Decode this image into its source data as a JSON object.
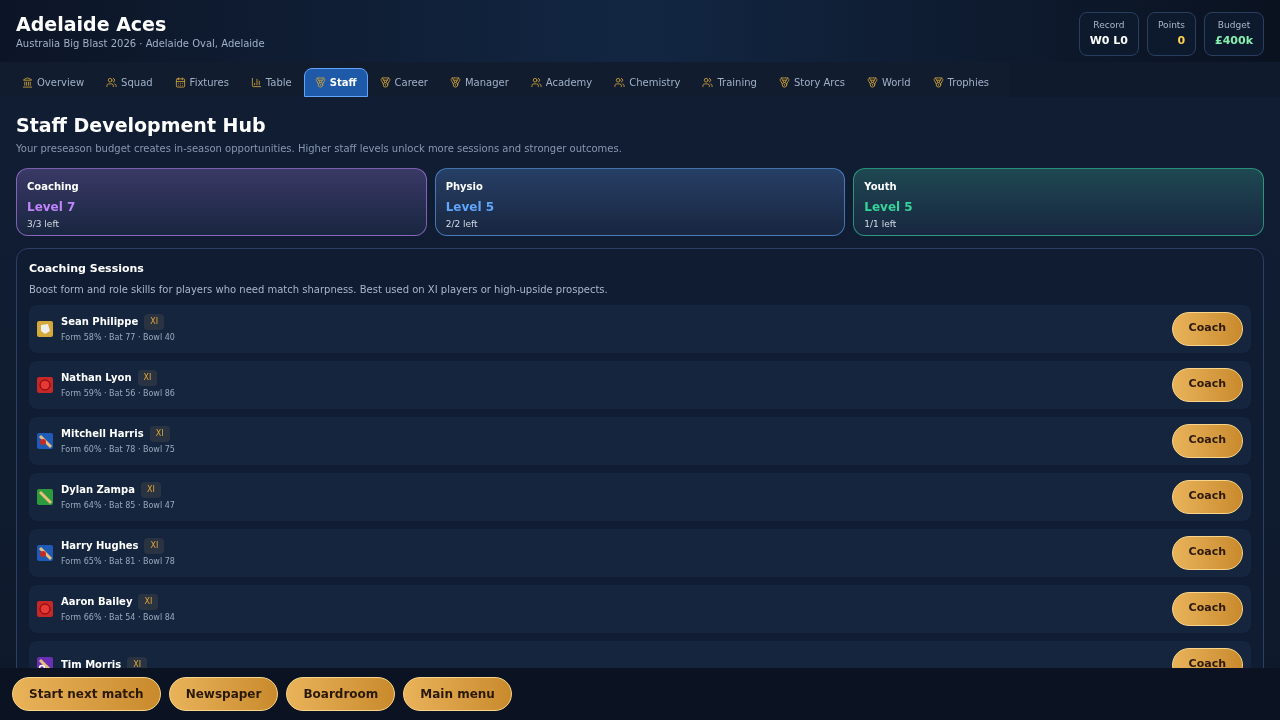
{
  "header": {
    "title": "Adelaide Aces",
    "subtitle": "Australia Big Blast 2026 · Adelaide Oval, Adelaide",
    "stats": [
      {
        "label": "Record",
        "value": "W0 L0",
        "color": "#ffffff"
      },
      {
        "label": "Points",
        "value": "0",
        "color": "#fcd34d"
      },
      {
        "label": "Budget",
        "value": "£400k",
        "color": "#86efac"
      }
    ]
  },
  "tabs": [
    {
      "label": "Overview",
      "kind": "stadium",
      "selected": false
    },
    {
      "label": "Squad",
      "kind": "people",
      "selected": false
    },
    {
      "label": "Fixtures",
      "kind": "calendar",
      "selected": false
    },
    {
      "label": "Table",
      "kind": "chart",
      "selected": false
    },
    {
      "label": "Staff",
      "kind": "medal",
      "selected": true
    },
    {
      "label": "Career",
      "kind": "medal",
      "selected": false
    },
    {
      "label": "Manager",
      "kind": "medal",
      "selected": false
    },
    {
      "label": "Academy",
      "kind": "people",
      "selected": false
    },
    {
      "label": "Chemistry",
      "kind": "people",
      "selected": false
    },
    {
      "label": "Training",
      "kind": "people",
      "selected": false
    },
    {
      "label": "Story Arcs",
      "kind": "medal",
      "selected": false
    },
    {
      "label": "World",
      "kind": "medal",
      "selected": false
    },
    {
      "label": "Trophies",
      "kind": "medal",
      "selected": false
    }
  ],
  "page": {
    "title": "Staff Development Hub",
    "description": "Your preseason budget creates in-season opportunities. Higher staff levels unlock more sessions and stronger outcomes."
  },
  "staff": [
    {
      "name": "Coaching",
      "level": "Level 7",
      "left": "3/3 left",
      "color": "#c084fc"
    },
    {
      "name": "Physio",
      "level": "Level 5",
      "left": "2/2 left",
      "color": "#60a5fa"
    },
    {
      "name": "Youth",
      "level": "Level 5",
      "left": "1/1 left",
      "color": "#34d399"
    }
  ],
  "sessions": {
    "title": "Coaching Sessions",
    "description": "Boost form and role skills for players who need match sharpness. Best used on XI players or high-upside prospects.",
    "players": [
      {
        "name": "Sean Philippe",
        "badge": "XI",
        "stats": "Form 58% · Bat 77 · Bowl 40",
        "kind": "keeper",
        "action": "Coach"
      },
      {
        "name": "Nathan Lyon",
        "badge": "XI",
        "stats": "Form 59% · Bat 56 · Bowl 86",
        "kind": "bowler",
        "action": "Coach"
      },
      {
        "name": "Mitchell Harris",
        "badge": "XI",
        "stats": "Form 60% · Bat 78 · Bowl 75",
        "kind": "allrounder",
        "action": "Coach"
      },
      {
        "name": "Dylan Zampa",
        "badge": "XI",
        "stats": "Form 64% · Bat 85 · Bowl 47",
        "kind": "batter",
        "action": "Coach"
      },
      {
        "name": "Harry Hughes",
        "badge": "XI",
        "stats": "Form 65% · Bat 81 · Bowl 78",
        "kind": "allrounder",
        "action": "Coach"
      },
      {
        "name": "Aaron Bailey",
        "badge": "XI",
        "stats": "Form 66% · Bat 54 · Bowl 84",
        "kind": "bowler",
        "action": "Coach"
      },
      {
        "name": "Tim Morris",
        "badge": "XI",
        "kind": "spinner",
        "action": "Coach"
      }
    ]
  },
  "footer": [
    "Start next match",
    "Newspaper",
    "Boardroom",
    "Main menu"
  ]
}
